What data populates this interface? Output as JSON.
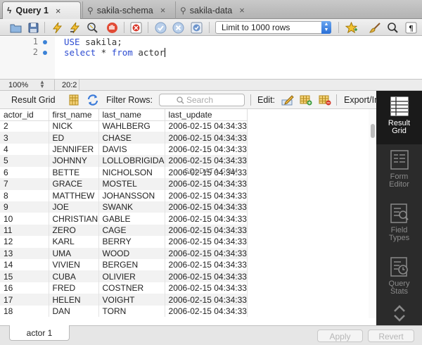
{
  "tabs": [
    {
      "label": "Query 1",
      "active": true,
      "icon": "bolt-icon"
    },
    {
      "label": "sakila-schema",
      "active": false,
      "icon": "wrench-icon"
    },
    {
      "label": "sakila-data",
      "active": false,
      "icon": "wrench-icon"
    }
  ],
  "close_glyph": "×",
  "toolbar": {
    "limit_select": "Limit to 1000 rows",
    "icons": [
      "open-folder-icon",
      "save-icon",
      "execute-icon",
      "execute-current-icon",
      "explain-icon",
      "stop-icon",
      "error-stop-icon",
      "commit-icon",
      "rollback-icon",
      "autocommit-icon",
      "star-icon",
      "brush-icon",
      "find-icon",
      "invisible-chars-icon"
    ]
  },
  "editor": {
    "lines": [
      {
        "number": "1",
        "keyword": "USE",
        "rest": " sakila;"
      },
      {
        "number": "2",
        "keyword": "select",
        "rest": " * ",
        "keyword2": "from",
        "rest2": " actor"
      }
    ]
  },
  "status": {
    "zoom": "100%",
    "position": "20:2"
  },
  "result_toolbar": {
    "result_grid_label": "Result Grid",
    "filter_label": "Filter Rows:",
    "search_placeholder": "Search",
    "edit_label": "Edit:",
    "export_label": "Export/Im"
  },
  "grid": {
    "columns": [
      "actor_id",
      "first_name",
      "last_name",
      "last_update"
    ],
    "rows": [
      [
        "2",
        "NICK",
        "WAHLBERG",
        "2006-02-15 04:34:33"
      ],
      [
        "3",
        "ED",
        "CHASE",
        "2006-02-15 04:34:33"
      ],
      [
        "4",
        "JENNIFER",
        "DAVIS",
        "2006-02-15 04:34:33"
      ],
      [
        "5",
        "JOHNNY",
        "LOLLOBRIGIDA",
        "2006-02-15 04:34:33"
      ],
      [
        "6",
        "BETTE",
        "NICHOLSON",
        "2006-02-15 04:34:33"
      ],
      [
        "7",
        "GRACE",
        "MOSTEL",
        "2006-02-15 04:34:33"
      ],
      [
        "8",
        "MATTHEW",
        "JOHANSSON",
        "2006-02-15 04:34:33"
      ],
      [
        "9",
        "JOE",
        "SWANK",
        "2006-02-15 04:34:33"
      ],
      [
        "10",
        "CHRISTIAN",
        "GABLE",
        "2006-02-15 04:34:33"
      ],
      [
        "11",
        "ZERO",
        "CAGE",
        "2006-02-15 04:34:33"
      ],
      [
        "12",
        "KARL",
        "BERRY",
        "2006-02-15 04:34:33"
      ],
      [
        "13",
        "UMA",
        "WOOD",
        "2006-02-15 04:34:33"
      ],
      [
        "14",
        "VIVIEN",
        "BERGEN",
        "2006-02-15 04:34:33"
      ],
      [
        "15",
        "CUBA",
        "OLIVIER",
        "2006-02-15 04:34:33"
      ],
      [
        "16",
        "FRED",
        "COSTNER",
        "2006-02-15 04:34:33"
      ],
      [
        "17",
        "HELEN",
        "VOIGHT",
        "2006-02-15 04:34:33"
      ],
      [
        "18",
        "DAN",
        "TORN",
        "2006-02-15 04:34:33"
      ]
    ]
  },
  "watermark": "SQLDAT4.COM",
  "side_panel": [
    {
      "label_1": "Result",
      "label_2": "Grid",
      "active": true
    },
    {
      "label_1": "Form",
      "label_2": "Editor",
      "active": false
    },
    {
      "label_1": "Field",
      "label_2": "Types",
      "active": false
    },
    {
      "label_1": "Query",
      "label_2": "Stats",
      "active": false
    }
  ],
  "bottom": {
    "result_tab": "actor 1",
    "apply": "Apply",
    "revert": "Revert"
  },
  "colors": {
    "keyword": "#2d4cd1",
    "side_panel_bg": "#2b2b2b",
    "accent_blue": "#2a6fd6"
  }
}
